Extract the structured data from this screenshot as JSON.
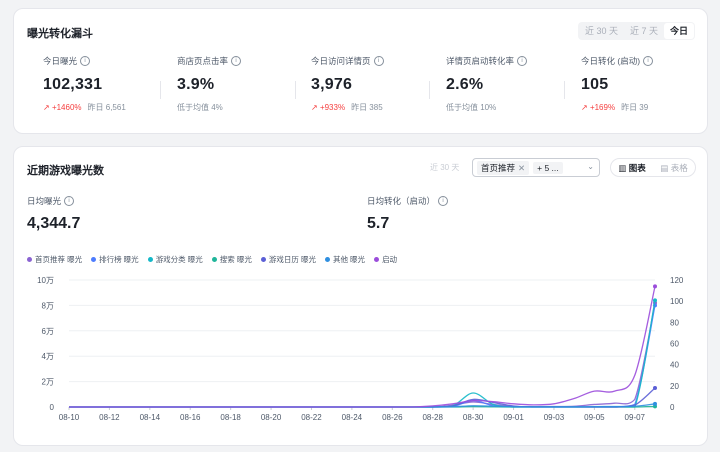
{
  "funnel": {
    "title": "曝光转化漏斗",
    "range_options": [
      "近 30 天",
      "近 7 天",
      "今日"
    ],
    "metrics": [
      {
        "label": "今日曝光",
        "value": "102,331",
        "change": "+1460%",
        "sub": "昨日 6,561"
      },
      {
        "label": "商店页点击率",
        "value": "3.9%",
        "sub": "低于均值 4%"
      },
      {
        "label": "今日访问详情页",
        "value": "3,976",
        "change": "+933%",
        "sub": "昨日 385"
      },
      {
        "label": "详情页启动转化率",
        "value": "2.6%",
        "sub": "低于均值 10%"
      },
      {
        "label": "今日转化 (启动)",
        "value": "105",
        "change": "+169%",
        "sub": "昨日 39"
      }
    ]
  },
  "exposure": {
    "title": "近期游戏曝光数",
    "range_label": "近 30 天",
    "selected_tag": "首页推荐",
    "more_tag": "+ 5 ...",
    "view_chart": "图表",
    "view_table": "表格",
    "avg_exposure_label": "日均曝光",
    "avg_exposure_value": "4,344.7",
    "avg_conv_label": "日均转化（启动）",
    "avg_conv_value": "5.7"
  },
  "chart_data": {
    "type": "line",
    "legend_position": "top-left",
    "grid": true,
    "x": [
      "08-10",
      "08-11",
      "08-12",
      "08-13",
      "08-14",
      "08-15",
      "08-16",
      "08-17",
      "08-18",
      "08-19",
      "08-20",
      "08-21",
      "08-22",
      "08-23",
      "08-24",
      "08-25",
      "08-26",
      "08-27",
      "08-28",
      "08-29",
      "08-30",
      "08-31",
      "09-01",
      "09-02",
      "09-03",
      "09-04",
      "09-05",
      "09-06",
      "09-07",
      "09-08"
    ],
    "x_tick_labels": [
      "08-10",
      "08-12",
      "08-14",
      "08-16",
      "08-18",
      "08-20",
      "08-22",
      "08-24",
      "08-26",
      "08-28",
      "08-30",
      "09-01",
      "09-03",
      "09-05",
      "09-07"
    ],
    "y_left": {
      "ticks": [
        "0",
        "2万",
        "4万",
        "6万",
        "8万",
        "10万"
      ],
      "ylim": [
        0,
        100000
      ]
    },
    "y_right": {
      "ticks": [
        "0",
        "20",
        "40",
        "60",
        "80",
        "100",
        "120"
      ],
      "ylim": [
        0,
        120
      ]
    },
    "series": [
      {
        "name": "首页推荐 曝光",
        "axis": "left",
        "color": "#8a63d2",
        "values": [
          0,
          0,
          0,
          0,
          0,
          0,
          0,
          0,
          0,
          0,
          0,
          0,
          0,
          0,
          0,
          0,
          0,
          0,
          0,
          1500,
          4000,
          2000,
          500,
          300,
          400,
          600,
          2000,
          3000,
          6000,
          82000
        ]
      },
      {
        "name": "排行榜 曝光",
        "axis": "left",
        "color": "#4d7cfe",
        "values": [
          0,
          0,
          0,
          0,
          0,
          0,
          0,
          0,
          0,
          0,
          0,
          0,
          0,
          0,
          0,
          0,
          0,
          0,
          0,
          500,
          5000,
          1000,
          0,
          0,
          0,
          0,
          0,
          0,
          2000,
          80000
        ]
      },
      {
        "name": "游戏分类 曝光",
        "axis": "left",
        "color": "#14b8c8",
        "values": [
          0,
          0,
          0,
          0,
          0,
          0,
          0,
          0,
          0,
          0,
          0,
          0,
          0,
          0,
          0,
          0,
          0,
          0,
          0,
          1000,
          11000,
          2000,
          0,
          0,
          0,
          0,
          0,
          0,
          0,
          84000
        ]
      },
      {
        "name": "搜索 曝光",
        "axis": "left",
        "color": "#1fb59a",
        "values": [
          0,
          0,
          0,
          0,
          0,
          0,
          0,
          0,
          0,
          0,
          0,
          0,
          0,
          0,
          0,
          0,
          0,
          0,
          0,
          0,
          300,
          100,
          0,
          0,
          0,
          0,
          0,
          0,
          0,
          500
        ]
      },
      {
        "name": "游戏日历 曝光",
        "axis": "left",
        "color": "#5b5fd6",
        "values": [
          0,
          0,
          0,
          0,
          0,
          0,
          0,
          0,
          0,
          0,
          0,
          0,
          0,
          0,
          0,
          0,
          0,
          0,
          0,
          800,
          6000,
          3500,
          800,
          0,
          0,
          0,
          0,
          0,
          1500,
          15000
        ]
      },
      {
        "name": "其他 曝光",
        "axis": "left",
        "color": "#2f8fe0",
        "values": [
          0,
          0,
          0,
          0,
          0,
          0,
          0,
          0,
          0,
          0,
          0,
          0,
          0,
          0,
          0,
          0,
          0,
          0,
          0,
          200,
          1000,
          600,
          200,
          100,
          100,
          100,
          300,
          400,
          600,
          2500
        ]
      },
      {
        "name": "启动",
        "axis": "right",
        "color": "#9b4ddb",
        "values": [
          0,
          0,
          0,
          0,
          0,
          0,
          0,
          0,
          0,
          0,
          0,
          0,
          0,
          0,
          0,
          0,
          0,
          0,
          1,
          3,
          6,
          5,
          3,
          2,
          3,
          8,
          15,
          15,
          30,
          114
        ]
      }
    ]
  }
}
